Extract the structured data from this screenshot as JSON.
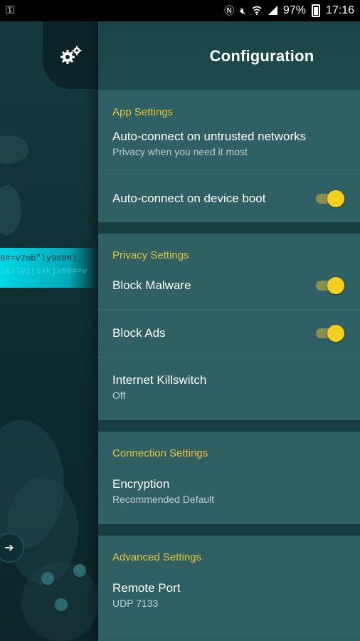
{
  "status_bar": {
    "left_icon": "key-icon",
    "battery": "97%",
    "time": "17:16",
    "icons": [
      "nfc-icon",
      "mute-icon",
      "wifi-icon",
      "signal-icon",
      "battery-icon"
    ]
  },
  "background": {
    "settings_button_icon": "gears-icon",
    "stream_line1": "8#=v7mb\"ly9#8M)_",
    "stream_line2": ":aJly1(sxkjx80#=v"
  },
  "panel": {
    "title": "Configuration",
    "sections": [
      {
        "heading": "App Settings",
        "rows": [
          {
            "title": "Auto-connect on untrusted networks",
            "subtitle": "Privacy when you need it most"
          },
          {
            "title": "Auto-connect on device boot",
            "toggle": true
          }
        ]
      },
      {
        "heading": "Privacy Settings",
        "rows": [
          {
            "title": "Block Malware",
            "toggle": true
          },
          {
            "title": "Block Ads",
            "toggle": true
          },
          {
            "title": "Internet Killswitch",
            "subtitle": "Off"
          }
        ]
      },
      {
        "heading": "Connection Settings",
        "rows": [
          {
            "title": "Encryption",
            "subtitle": "Recommended Default"
          }
        ]
      },
      {
        "heading": "Advanced Settings",
        "rows": [
          {
            "title": "Remote Port",
            "subtitle": "UDP 7133"
          }
        ]
      }
    ]
  },
  "colors": {
    "accent": "#e8c23a",
    "toggle_on": "#f5cf20",
    "panel_bg": "#2f6164",
    "divider_band": "#173e40"
  }
}
